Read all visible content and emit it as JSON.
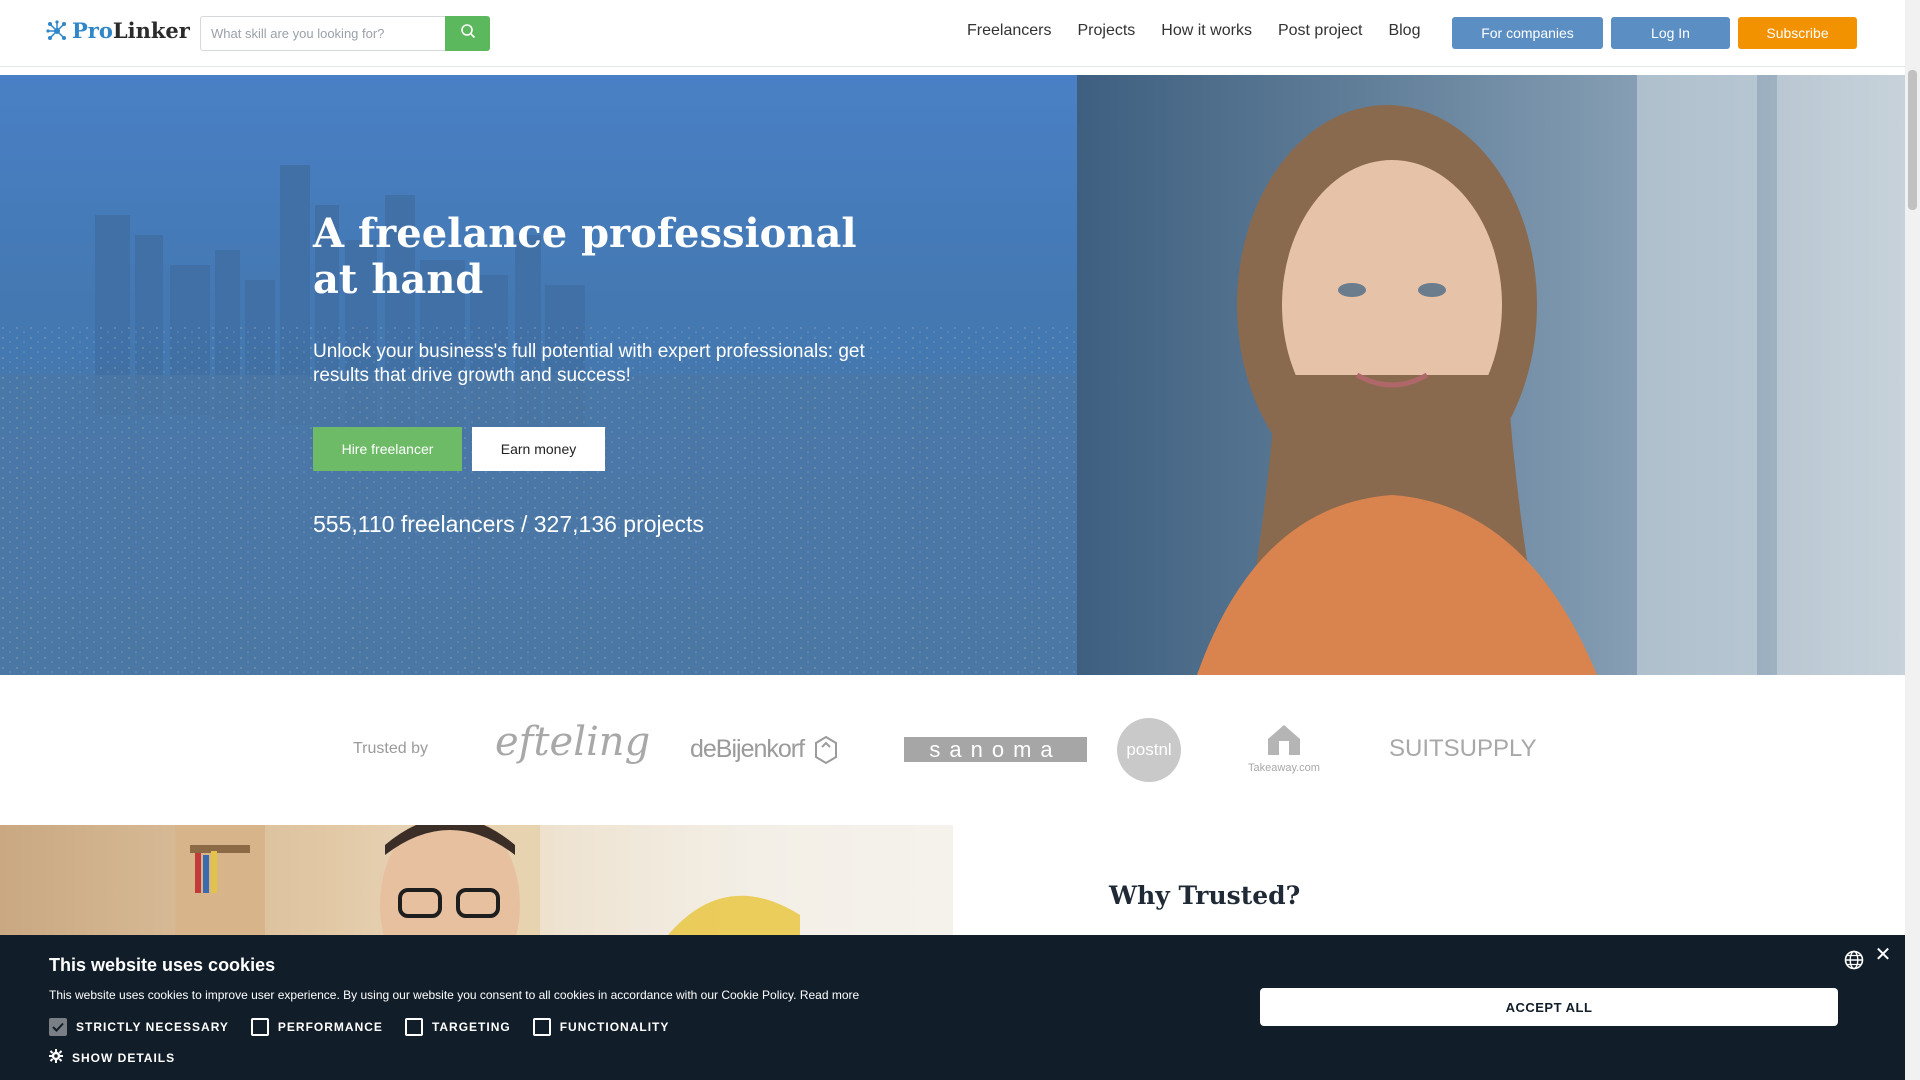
{
  "header": {
    "logo": {
      "pro": "Pro",
      "linker": "Linker"
    },
    "search": {
      "placeholder": "What skill are you looking for?",
      "value": ""
    },
    "nav": [
      "Freelancers",
      "Projects",
      "How it works",
      "Post project",
      "Blog"
    ],
    "buttons": {
      "companies": "For companies",
      "login": "Log In",
      "subscribe": "Subscribe"
    },
    "colors": {
      "primary": "#5b8fc4",
      "subscribe": "#f39200",
      "search_button": "#5cb85c"
    }
  },
  "hero": {
    "title": "A freelance professional at hand",
    "subtitle": "Unlock your business's full potential with expert professionals: get results that drive growth and success!",
    "hire_label": "Hire freelancer",
    "earn_label": "Earn money",
    "stats": "555,110 freelancers / 327,136 projects",
    "colors": {
      "hire": "#6dbb67"
    }
  },
  "trusted": {
    "label": "Trusted by",
    "brands": [
      "efteling",
      "deBijenkorf",
      "sanoma",
      "postnl",
      "Takeaway.com",
      "SUITSUPPLY"
    ]
  },
  "why": {
    "title": "Why Trusted?"
  },
  "cookie": {
    "title": "This website uses cookies",
    "text": "This website uses cookies to improve user experience. By using our website you consent to all cookies in accordance with our Cookie Policy.",
    "read_more": "Read more",
    "options": [
      {
        "label": "STRICTLY NECESSARY",
        "checked": true
      },
      {
        "label": "PERFORMANCE",
        "checked": false
      },
      {
        "label": "TARGETING",
        "checked": false
      },
      {
        "label": "FUNCTIONALITY",
        "checked": false
      }
    ],
    "show_details": "SHOW DETAILS",
    "accept": "ACCEPT ALL",
    "colors": {
      "background": "#111d28"
    }
  }
}
